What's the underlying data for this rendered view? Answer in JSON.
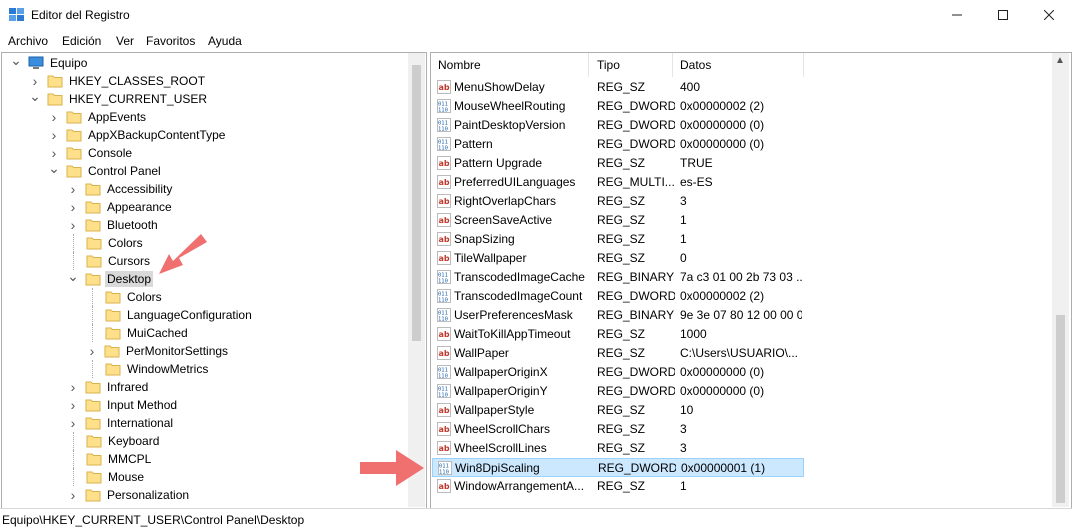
{
  "window": {
    "title": "Editor del Registro",
    "icon": "registry-icon",
    "controls": [
      "minimize-icon",
      "maximize-icon",
      "close-icon"
    ]
  },
  "menu": [
    "Archivo",
    "Edición",
    "Ver",
    "Favoritos",
    "Ayuda"
  ],
  "tree": [
    {
      "label": "Equipo",
      "level": 0,
      "chevron": "down",
      "icon": "computer-icon"
    },
    {
      "label": "HKEY_CLASSES_ROOT",
      "level": 1,
      "chevron": "right"
    },
    {
      "label": "HKEY_CURRENT_USER",
      "level": 1,
      "chevron": "down"
    },
    {
      "label": "AppEvents",
      "level": 2,
      "chevron": "right"
    },
    {
      "label": "AppXBackupContentType",
      "level": 2,
      "chevron": "right"
    },
    {
      "label": "Console",
      "level": 2,
      "chevron": "right"
    },
    {
      "label": "Control Panel",
      "level": 2,
      "chevron": "down"
    },
    {
      "label": "Accessibility",
      "level": 3,
      "chevron": "right"
    },
    {
      "label": "Appearance",
      "level": 3,
      "chevron": "right"
    },
    {
      "label": "Bluetooth",
      "level": 3,
      "chevron": "right"
    },
    {
      "label": "Colors",
      "level": 3,
      "chevron": ""
    },
    {
      "label": "Cursors",
      "level": 3,
      "chevron": ""
    },
    {
      "label": "Desktop",
      "level": 3,
      "chevron": "down",
      "selected": true
    },
    {
      "label": "Colors",
      "level": 4,
      "chevron": ""
    },
    {
      "label": "LanguageConfiguration",
      "level": 4,
      "chevron": ""
    },
    {
      "label": "MuiCached",
      "level": 4,
      "chevron": ""
    },
    {
      "label": "PerMonitorSettings",
      "level": 4,
      "chevron": "right"
    },
    {
      "label": "WindowMetrics",
      "level": 4,
      "chevron": ""
    },
    {
      "label": "Infrared",
      "level": 3,
      "chevron": "right"
    },
    {
      "label": "Input Method",
      "level": 3,
      "chevron": "right"
    },
    {
      "label": "International",
      "level": 3,
      "chevron": "right"
    },
    {
      "label": "Keyboard",
      "level": 3,
      "chevron": ""
    },
    {
      "label": "MMCPL",
      "level": 3,
      "chevron": ""
    },
    {
      "label": "Mouse",
      "level": 3,
      "chevron": ""
    },
    {
      "label": "Personalization",
      "level": 3,
      "chevron": "right"
    }
  ],
  "columns": [
    "Nombre",
    "Tipo",
    "Datos"
  ],
  "values": [
    {
      "name": "MenuShowDelay",
      "type": "REG_SZ",
      "data": "400",
      "icon": "string-value-icon"
    },
    {
      "name": "MouseWheelRouting",
      "type": "REG_DWORD",
      "data": "0x00000002 (2)",
      "icon": "binary-value-icon"
    },
    {
      "name": "PaintDesktopVersion",
      "type": "REG_DWORD",
      "data": "0x00000000 (0)",
      "icon": "binary-value-icon"
    },
    {
      "name": "Pattern",
      "type": "REG_DWORD",
      "data": "0x00000000 (0)",
      "icon": "binary-value-icon"
    },
    {
      "name": "Pattern Upgrade",
      "type": "REG_SZ",
      "data": "TRUE",
      "icon": "string-value-icon"
    },
    {
      "name": "PreferredUILanguages",
      "type": "REG_MULTI...",
      "data": "es-ES",
      "icon": "string-value-icon"
    },
    {
      "name": "RightOverlapChars",
      "type": "REG_SZ",
      "data": "3",
      "icon": "string-value-icon"
    },
    {
      "name": "ScreenSaveActive",
      "type": "REG_SZ",
      "data": "1",
      "icon": "string-value-icon"
    },
    {
      "name": "SnapSizing",
      "type": "REG_SZ",
      "data": "1",
      "icon": "string-value-icon"
    },
    {
      "name": "TileWallpaper",
      "type": "REG_SZ",
      "data": "0",
      "icon": "string-value-icon"
    },
    {
      "name": "TranscodedImageCache",
      "type": "REG_BINARY",
      "data": "7a c3 01 00 2b 73 03 ...",
      "icon": "binary-value-icon"
    },
    {
      "name": "TranscodedImageCount",
      "type": "REG_DWORD",
      "data": "0x00000002 (2)",
      "icon": "binary-value-icon"
    },
    {
      "name": "UserPreferencesMask",
      "type": "REG_BINARY",
      "data": "9e 3e 07 80 12 00 00 00",
      "icon": "binary-value-icon"
    },
    {
      "name": "WaitToKillAppTimeout",
      "type": "REG_SZ",
      "data": "1000",
      "icon": "string-value-icon"
    },
    {
      "name": "WallPaper",
      "type": "REG_SZ",
      "data": "C:\\Users\\USUARIO\\...",
      "icon": "string-value-icon"
    },
    {
      "name": "WallpaperOriginX",
      "type": "REG_DWORD",
      "data": "0x00000000 (0)",
      "icon": "binary-value-icon"
    },
    {
      "name": "WallpaperOriginY",
      "type": "REG_DWORD",
      "data": "0x00000000 (0)",
      "icon": "binary-value-icon"
    },
    {
      "name": "WallpaperStyle",
      "type": "REG_SZ",
      "data": "10",
      "icon": "string-value-icon"
    },
    {
      "name": "WheelScrollChars",
      "type": "REG_SZ",
      "data": "3",
      "icon": "string-value-icon"
    },
    {
      "name": "WheelScrollLines",
      "type": "REG_SZ",
      "data": "3",
      "icon": "string-value-icon"
    },
    {
      "name": "Win8DpiScaling",
      "type": "REG_DWORD",
      "data": "0x00000001 (1)",
      "icon": "binary-value-icon",
      "selected": true
    },
    {
      "name": "WindowArrangementA...",
      "type": "REG_SZ",
      "data": "1",
      "icon": "string-value-icon"
    }
  ],
  "status": "Equipo\\HKEY_CURRENT_USER\\Control Panel\\Desktop",
  "colors": {
    "selection": "#cce8ff",
    "selection_border": "#99d1ff",
    "tree_selection": "#d9d9d9",
    "folder": "#ffe08a",
    "annotation_arrow": "#f07070"
  }
}
